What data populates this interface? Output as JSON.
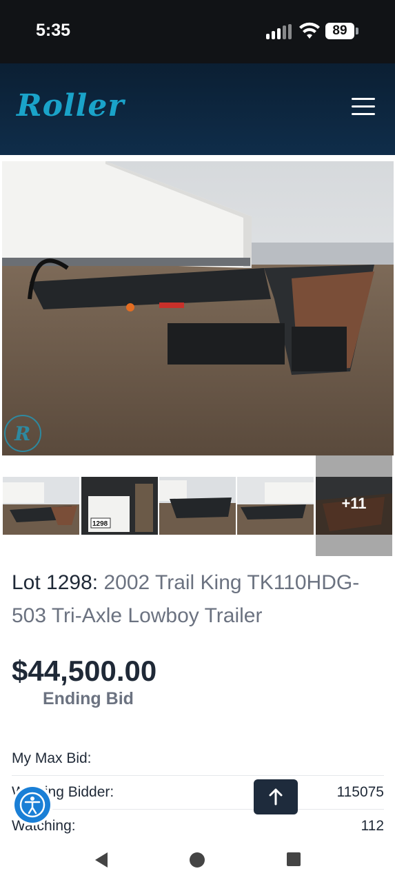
{
  "status_bar": {
    "time": "5:35",
    "battery": "89"
  },
  "header": {
    "logo_text": "Roller"
  },
  "gallery": {
    "more_label": "+11",
    "thumb_lot_tag": "1298"
  },
  "listing": {
    "lot_label": "Lot 1298:",
    "title": "2002 Trail King TK110HDG-503 Tri-Axle Lowboy Trailer",
    "price": "$44,500.00",
    "price_label": "Ending Bid"
  },
  "details": [
    {
      "label": "My Max Bid:",
      "value": ""
    },
    {
      "label": "Winning Bidder:",
      "value": "115075"
    },
    {
      "label": "Watching:",
      "value": "112"
    }
  ],
  "colors": {
    "brand_accent": "#1aa3c9",
    "header_bg": "#0f2d4a",
    "text_dark": "#1f2937",
    "text_muted": "#6b7280"
  }
}
